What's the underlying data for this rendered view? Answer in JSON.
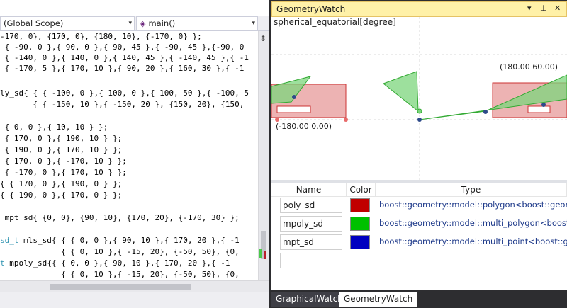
{
  "nav": {
    "scope_label": "(Global Scope)",
    "function_label": "main()"
  },
  "code_lines": [
    "-170, 0}, {170, 0}, {180, 10}, {-170, 0} };",
    " { -90, 0 },{ 90, 0 },{ 90, 45 },{ -90, 45 },{-90, 0",
    " { -140, 0 },{ 140, 0 },{ 140, 45 },{ -140, 45 },{ -1",
    " { -170, 5 },{ 170, 10 },{ 90, 20 },{ 160, 30 },{ -1",
    "",
    "ly_sd{ { { -100, 0 },{ 100, 0 },{ 100, 50 },{ -100, 5",
    "       { { -150, 10 },{ -150, 20 }, {150, 20}, {150,",
    "",
    " { 0, 0 },{ 10, 10 } };",
    " { 170, 0 },{ 190, 10 } };",
    " { 190, 0 },{ 170, 10 } };",
    " { 170, 0 },{ -170, 10 } };",
    " { -170, 0 },{ 170, 10 } };",
    "{ { 170, 0 },{ 190, 0 } };",
    "{ { 190, 0 },{ 170, 0 } };",
    "",
    " mpt_sd{ {0, 0}, {90, 10}, {170, 20}, {-170, 30} };",
    "",
    "sd_t mls_sd{ { { 0, 0 },{ 90, 10 },{ 170, 20 },{ -1",
    "             { { 0, 10 },{ -15, 20}, {-50, 50}, {0,",
    "t mpoly_sd{{ { 0, 0 },{ 90, 10 },{ 170, 20 },{ -1",
    "             { { 0, 10 },{ -15, 20}, {-50, 50}, {0,"
  ],
  "code_types": {
    "line18_prefix": "sd_t",
    "line20_prefix": "t"
  },
  "geometry_watch": {
    "title": "GeometryWatch",
    "pin_glyph": "⊥",
    "close_glyph": "✕",
    "drop_glyph": "▾",
    "coordinate_system": "spherical_equatorial[degree]",
    "label_max": "(180.00 60.00)",
    "label_min": "(-180.00 0.00)",
    "columns": {
      "name": "Name",
      "color": "Color",
      "type": "Type"
    },
    "rows": [
      {
        "name": "poly_sd",
        "color": "#c00000",
        "type": "boost::geometry::model::polygon<boost::geomet"
      },
      {
        "name": "mpoly_sd",
        "color": "#00c000",
        "type": "boost::geometry::model::multi_polygon<boost::g"
      },
      {
        "name": "mpt_sd",
        "color": "#0000c0",
        "type": "boost::geometry::model::multi_point<boost::geo"
      },
      {
        "name": "",
        "color": "",
        "type": ""
      }
    ]
  },
  "tabs": {
    "graphical": "GraphicalWatch",
    "geometry": "GeometryWatch"
  },
  "icons": {
    "split": "splitter-icon",
    "function": "function-icon"
  }
}
